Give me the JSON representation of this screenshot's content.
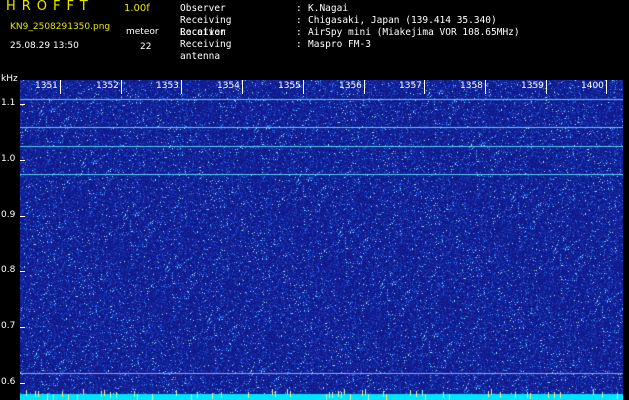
{
  "header": {
    "app_title": "HROFFT",
    "version": "1.00f",
    "filename": "KN9_2508291350.png",
    "datetime": "25.08.29 13:50",
    "meteor_label": "meteor",
    "meteor_count": "22",
    "info": [
      {
        "key": "Observer",
        "value": "K.Nagai"
      },
      {
        "key": "Receiving Location",
        "value": "Chigasaki, Japan (139.414 35.340)"
      },
      {
        "key": "Receiver",
        "value": "AirSpy mini (Miakejima VOR 108.65MHz)"
      },
      {
        "key": "Receiving antenna",
        "value": "Maspro FM-3"
      }
    ],
    "separator": ":"
  },
  "chart_data": {
    "type": "heatmap",
    "ylabel": "kHz",
    "x_ticks": [
      "1351",
      "1352",
      "1353",
      "1354",
      "1355",
      "1356",
      "1357",
      "1358",
      "1359",
      "1400"
    ],
    "y_ticks": [
      "1.1",
      "1.0",
      "0.9",
      "0.8",
      "0.7",
      "0.6"
    ],
    "ylim": [
      0.58,
      1.14
    ],
    "horizontal_lines_khz": [
      1.11,
      1.06,
      1.025,
      0.975,
      0.618
    ],
    "colors": {
      "background": "#101a8a",
      "noise": "#3a8cff",
      "line": "#5cf0ff",
      "baseline": "#00e5ff"
    }
  }
}
